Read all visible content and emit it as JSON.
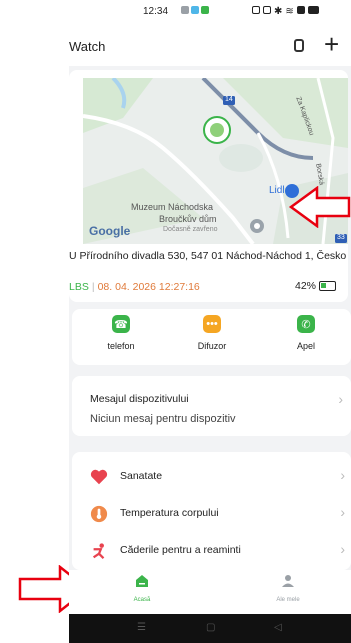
{
  "status_bar": {
    "time": "12:34"
  },
  "header": {
    "title": "Watch",
    "add_label": "+"
  },
  "location": {
    "address": "U Přírodního divadla 530, 547 01 Náchod-Náchod 1, Česko",
    "source": "LBS",
    "datetime": "08. 04. 2026 12:27:16",
    "battery": "42%",
    "battery_level": 0.42,
    "map_labels": {
      "museum_line1": "Muzeum Náchodska",
      "museum_line2": "Broučkův dům",
      "museum_line3": "Dočasně zavřeno",
      "store": "Lidl",
      "street1": "Za Kaplickou",
      "street2": "Borská",
      "road_badge": "14",
      "road_badge2": "33",
      "google": "Google"
    }
  },
  "actions": [
    {
      "label": "telefon",
      "icon": "phone-contact-icon",
      "color": "#3bb44a"
    },
    {
      "label": "Difuzor",
      "icon": "chat-bubble-icon",
      "color": "#f5a623"
    },
    {
      "label": "Apel",
      "icon": "call-icon",
      "color": "#3bb44a"
    }
  ],
  "messages": {
    "title": "Mesajul dispozitivului",
    "subtitle": "Niciun mesaj pentru dispozitiv"
  },
  "list": [
    {
      "label": "Sanatate",
      "icon": "heart-icon",
      "color": "#e8434f"
    },
    {
      "label": "Temperatura corpului",
      "icon": "thermometer-icon",
      "color": "#f08a4b"
    },
    {
      "label": "Căderile pentru a reaminti",
      "icon": "fall-person-icon",
      "color": "#e8434f"
    }
  ],
  "bottom_nav": {
    "home": "Acasă",
    "mine": "Ale mele",
    "active_color": "#3bb44a"
  },
  "accent": "#e8000f"
}
